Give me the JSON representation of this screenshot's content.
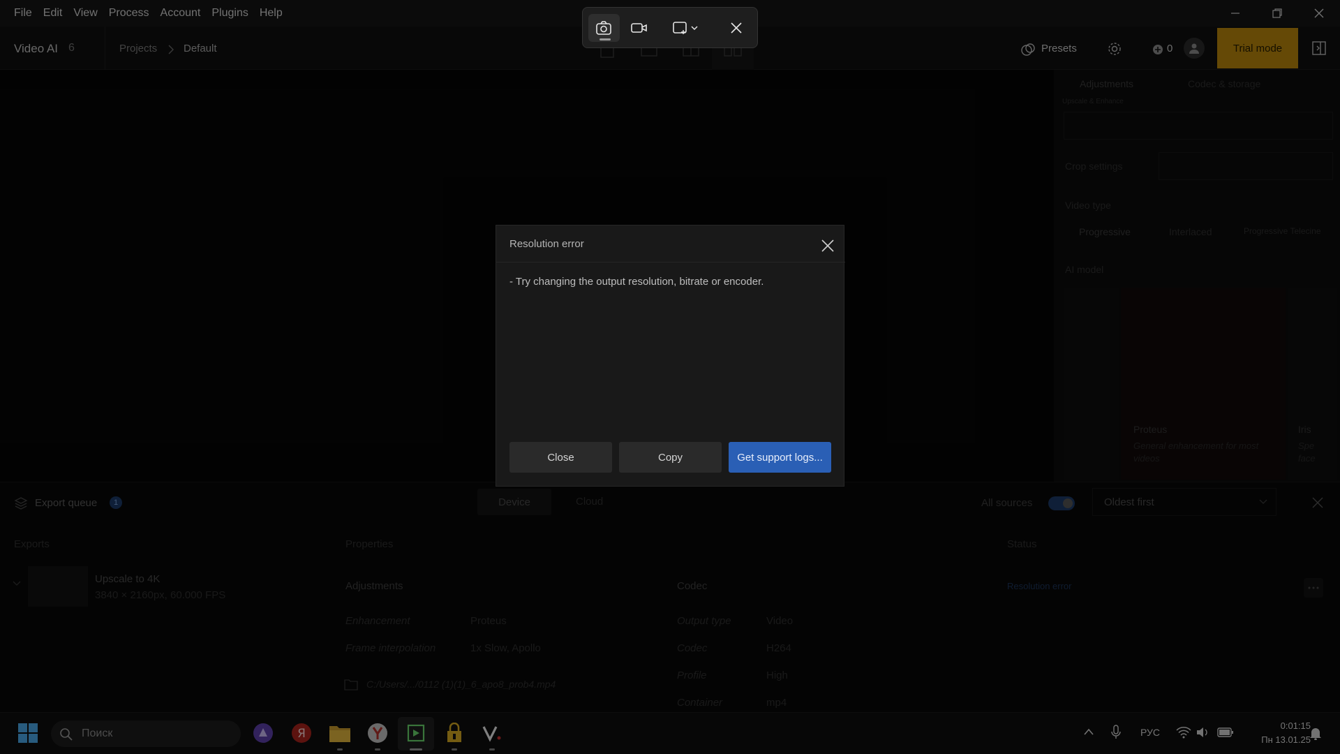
{
  "menu": [
    "File",
    "Edit",
    "View",
    "Process",
    "Account",
    "Plugins",
    "Help"
  ],
  "app": {
    "name": "Video AI",
    "version": "6",
    "breadcrumb": [
      "Projects",
      "Default"
    ],
    "presets": "Presets",
    "credits": "0",
    "trial": "Trial mode"
  },
  "right_panel": {
    "tabs": [
      "Adjustments",
      "Codec & storage"
    ],
    "small_label": "Upscale & Enhance",
    "crop_label": "Crop settings",
    "video_type_label": "Video type",
    "video_types": [
      "Progressive",
      "Interlaced",
      "Progressive Telecine"
    ],
    "ai_model_label": "AI model",
    "model_name": "Proteus",
    "model_desc": "General enhancement for most videos",
    "model_side": "Iris",
    "model_side_desc": "Spe face"
  },
  "queue": {
    "title": "Export queue",
    "count": "1",
    "tabs": [
      "Device",
      "Cloud"
    ],
    "all_sources": "All sources",
    "sort": "Oldest first",
    "columns": [
      "Exports",
      "Properties",
      "Status"
    ],
    "item": {
      "name": "Upscale to 4K",
      "meta": "3840 × 2160px, 60.000 FPS",
      "status": "Resolution error",
      "adjustments_header": "Adjustments",
      "codec_header": "Codec",
      "adjustments": [
        {
          "k": "Enhancement",
          "v": "Proteus"
        },
        {
          "k": "Frame interpolation",
          "v": "1x Slow, Apollo"
        }
      ],
      "codec": [
        {
          "k": "Output type",
          "v": "Video"
        },
        {
          "k": "Codec",
          "v": "H264"
        },
        {
          "k": "Profile",
          "v": "High"
        },
        {
          "k": "Container",
          "v": "mp4"
        }
      ],
      "path": "C:/Users/.../0112 (1)(1)_6_apo8_prob4.mp4"
    }
  },
  "dialog": {
    "title": "Resolution error",
    "message": "- Try changing the output resolution, bitrate or encoder.",
    "buttons": {
      "close": "Close",
      "copy": "Copy",
      "support": "Get support logs..."
    }
  },
  "taskbar": {
    "search": "Поиск",
    "lang": "РУС",
    "time": "0:01:15",
    "date": "Пн 13.01.25"
  },
  "colors": {
    "accent": "#2a5fb5",
    "trial": "#b8860b"
  }
}
